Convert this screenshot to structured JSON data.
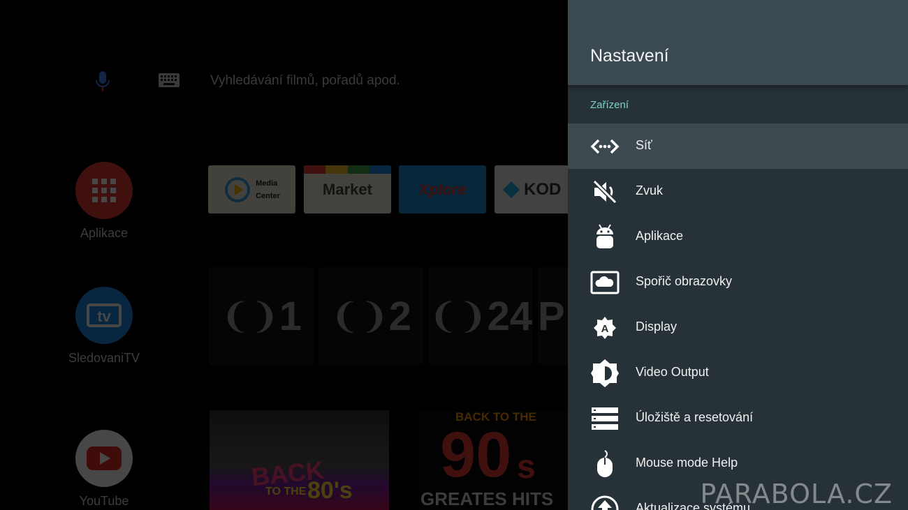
{
  "home": {
    "search_placeholder": "Vyhledávání filmů, pořadů apod.",
    "launchers": [
      {
        "label": "Aplikace",
        "color": "#e53935"
      },
      {
        "label": "SledovaniTV",
        "color": "#1e88e5"
      },
      {
        "label": "YouTube",
        "color": "#ffffff"
      }
    ],
    "app_tiles": [
      {
        "name": "Media Center",
        "line1": "Media",
        "line2": "Center"
      },
      {
        "name": "Market",
        "text": "Market"
      },
      {
        "name": "Xplore",
        "text": "Xplore"
      },
      {
        "name": "Kodi",
        "text": "KOD"
      }
    ],
    "channels": [
      "1",
      "2",
      "24"
    ],
    "poster_2": {
      "line1": "BACK TO THE",
      "line2": "90",
      "line3": "s",
      "line4": "GREATES HITS"
    },
    "poster_1": {
      "line1": "BACK",
      "line2": "TO THE",
      "line3": "80's"
    }
  },
  "settings": {
    "title": "Nastavení",
    "section": "Zařízení",
    "items": [
      {
        "label": "Síť",
        "icon": "network-icon",
        "selected": true
      },
      {
        "label": "Zvuk",
        "icon": "sound-muted-icon"
      },
      {
        "label": "Aplikace",
        "icon": "android-icon"
      },
      {
        "label": "Spořič obrazovky",
        "icon": "screensaver-icon"
      },
      {
        "label": "Display",
        "icon": "display-icon"
      },
      {
        "label": "Video Output",
        "icon": "brightness-icon"
      },
      {
        "label": "Úložiště a resetování",
        "icon": "storage-icon"
      },
      {
        "label": "Mouse mode Help",
        "icon": "mouse-icon"
      },
      {
        "label": "Aktualizace systému",
        "icon": "system-update-icon"
      }
    ]
  },
  "watermark": "PARABOLA.CZ"
}
